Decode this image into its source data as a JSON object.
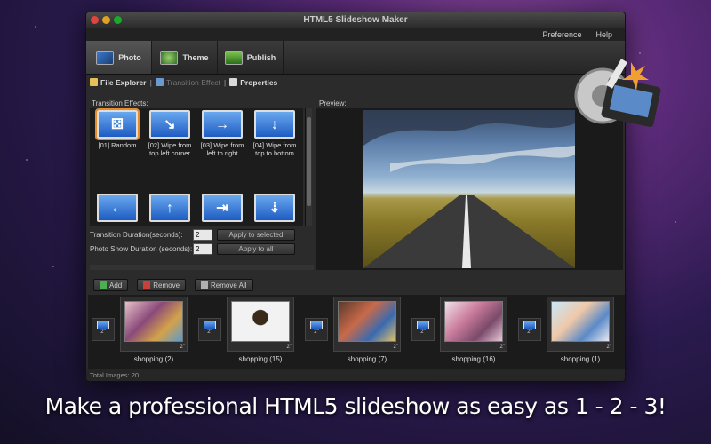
{
  "window": {
    "title": "HTML5 Slideshow Maker"
  },
  "menu": [
    "Preference",
    "Help"
  ],
  "main_tabs": [
    {
      "label": "Photo",
      "icon": "photo-icon"
    },
    {
      "label": "Theme",
      "icon": "theme-icon"
    },
    {
      "label": "Publish",
      "icon": "publish-icon"
    }
  ],
  "sub_tabs": {
    "file_explorer": "File Explorer",
    "transition_effect": "Transition Effect",
    "properties": "Properties"
  },
  "effects_panel": {
    "title": "Transition Effects:",
    "effects": [
      {
        "label": "[01] Random",
        "glyph": "⚄"
      },
      {
        "label": "[02] Wipe from top left corner",
        "glyph": "↘"
      },
      {
        "label": "[03] Wipe from left to right",
        "glyph": "→"
      },
      {
        "label": "[04] Wipe from top to bottom",
        "glyph": "↓"
      },
      {
        "label": "",
        "glyph": "←"
      },
      {
        "label": "",
        "glyph": "↑"
      },
      {
        "label": "",
        "glyph": "⇥"
      },
      {
        "label": "",
        "glyph": "⇣"
      }
    ]
  },
  "durations": {
    "transition_label": "Transition Duration(seconds):",
    "transition_value": "2",
    "apply_selected": "Apply to selected",
    "photo_label": "Photo Show Duration (seconds):",
    "photo_value": "2",
    "apply_all": "Apply to all"
  },
  "preview": {
    "title": "Preview:"
  },
  "strip_toolbar": {
    "add": "Add",
    "remove": "Remove",
    "remove_all": "Remove All"
  },
  "slides": [
    {
      "name": "shopping (2)",
      "duration": "2\""
    },
    {
      "name": "shopping (15)",
      "duration": "2\""
    },
    {
      "name": "shopping (7)",
      "duration": "2\""
    },
    {
      "name": "shopping (16)",
      "duration": "2\""
    },
    {
      "name": "shopping (1)",
      "duration": "2\""
    }
  ],
  "transitions": [
    "2\"",
    "2\"",
    "2\"",
    "2\"",
    "2\""
  ],
  "status": "Total Images: 20",
  "tagline": "Make a professional HTML5 slideshow as easy as 1 - 2 - 3!",
  "colors": {
    "selected_outline": "#e88a2a",
    "effect_blue": "#1e5cc2"
  }
}
